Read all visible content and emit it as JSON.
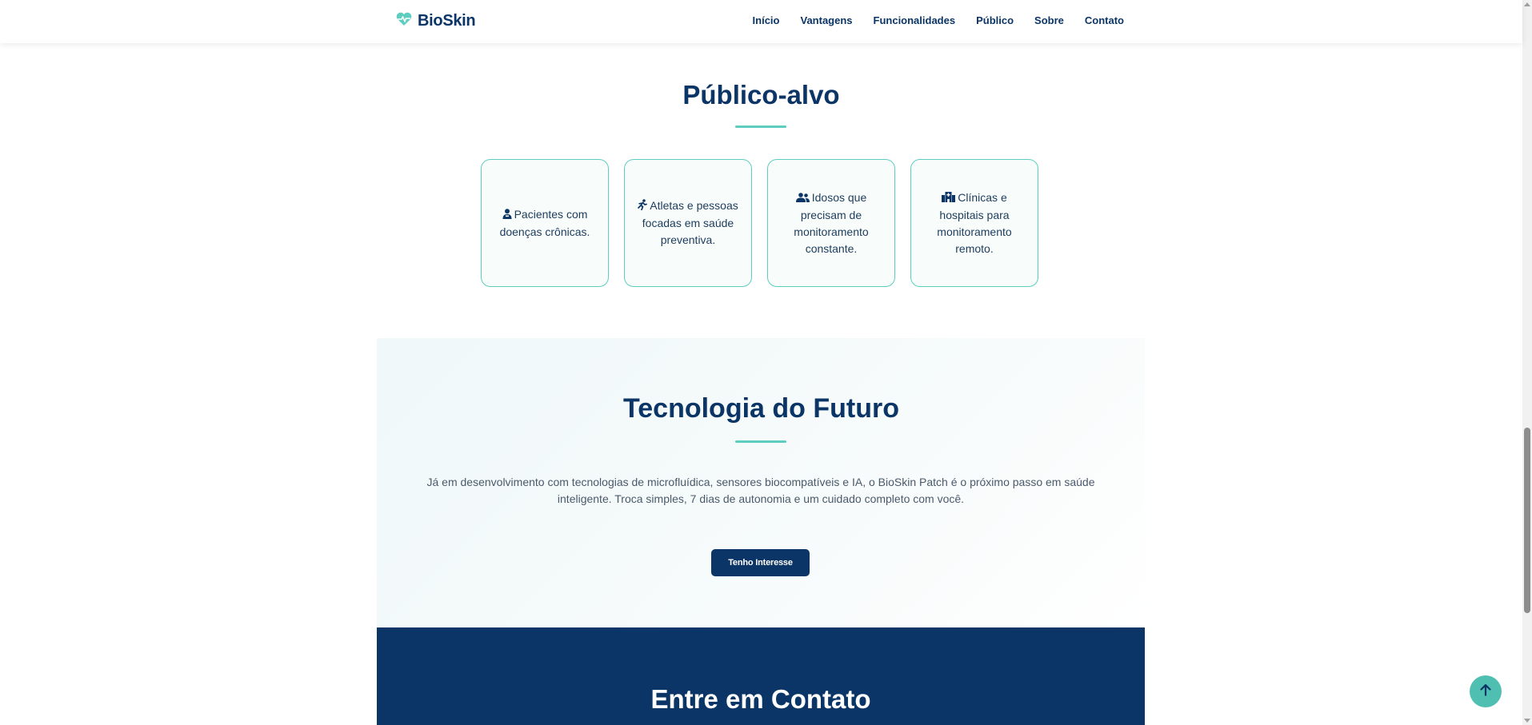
{
  "header": {
    "logo_text": "BioSkin",
    "nav": [
      "Início",
      "Vantagens",
      "Funcionalidades",
      "Público",
      "Sobre",
      "Contato"
    ]
  },
  "audience": {
    "title": "Público-alvo",
    "cards": [
      {
        "icon": "user-injured-icon",
        "text": "Pacientes com doenças crônicas."
      },
      {
        "icon": "running-icon",
        "text": "Atletas e pessoas focadas em saúde preventiva."
      },
      {
        "icon": "users-icon",
        "text": "Idosos que precisam de monitoramento constante."
      },
      {
        "icon": "hospital-icon",
        "text": "Clínicas e hospitais para monitoramento remoto."
      }
    ]
  },
  "tech": {
    "title": "Tecnologia do Futuro",
    "text": "Já em desenvolvimento com tecnologias de microfluídica, sensores biocompatíveis e IA, o BioSkin Patch é o próximo passo em saúde inteligente. Troca simples, 7 dias de autonomia e um cuidado completo com você.",
    "button": "Tenho Interesse"
  },
  "contact": {
    "title": "Entre em Contato"
  },
  "colors": {
    "primary": "#0b3566",
    "accent": "#5ccdbf"
  }
}
